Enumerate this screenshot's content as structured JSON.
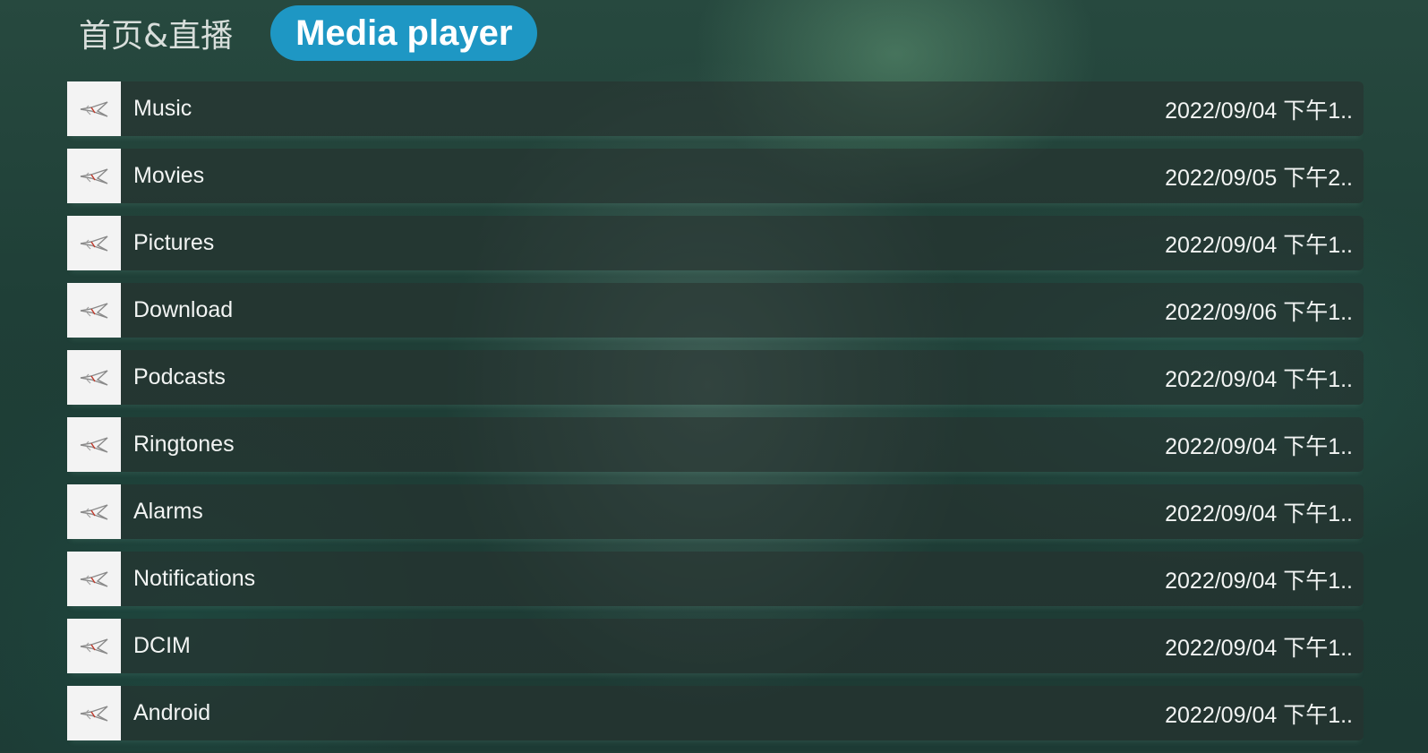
{
  "tabs": [
    {
      "label": "首页&直播",
      "active": false
    },
    {
      "label": "Media player",
      "active": true
    }
  ],
  "folders": [
    {
      "name": "Music",
      "date": "2022/09/04 下午1.."
    },
    {
      "name": "Movies",
      "date": "2022/09/05 下午2.."
    },
    {
      "name": "Pictures",
      "date": "2022/09/04 下午1.."
    },
    {
      "name": "Download",
      "date": "2022/09/06 下午1.."
    },
    {
      "name": "Podcasts",
      "date": "2022/09/04 下午1.."
    },
    {
      "name": "Ringtones",
      "date": "2022/09/04 下午1.."
    },
    {
      "name": "Alarms",
      "date": "2022/09/04 下午1.."
    },
    {
      "name": "Notifications",
      "date": "2022/09/04 下午1.."
    },
    {
      "name": "DCIM",
      "date": "2022/09/04 下午1.."
    },
    {
      "name": "Android",
      "date": "2022/09/04 下午1.."
    }
  ],
  "icons": {
    "folder_thumbnail": "folder-thumbnail-icon"
  },
  "colors": {
    "accent": "#1e97c4",
    "thumbnail_bg": "#f3f3f3"
  }
}
